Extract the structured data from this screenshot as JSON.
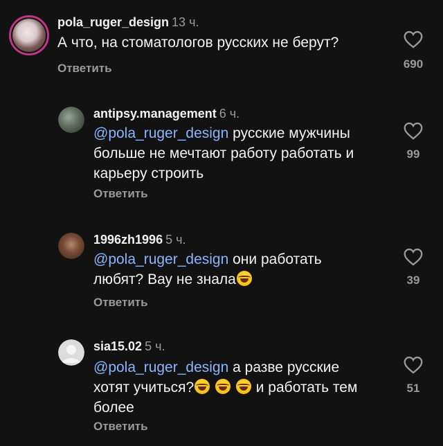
{
  "comments": [
    {
      "username": "pola_ruger_design",
      "time": "13 ч.",
      "text": "А что, на стоматологов русских не берут?",
      "reply_label": "Ответить",
      "likes": "690"
    },
    {
      "username": "antipsy.management",
      "time": "6 ч.",
      "mention": "@pola_ruger_design",
      "text": " русские мужчины больше не мечтают работу работать и карьеру строить",
      "reply_label": "Ответить",
      "likes": "99"
    },
    {
      "username": "1996zh1996",
      "time": "5 ч.",
      "mention": "@pola_ruger_design",
      "text": " они работать любят? Вау не знала",
      "emoji": "face-with-tears-of-joy",
      "reply_label": "Ответить",
      "likes": "39"
    },
    {
      "username": "sia15.02",
      "time": "5 ч.",
      "mention": "@pola_ruger_design",
      "text_a": " а разве русские хотят учиться?",
      "text_b": " и работать тем более",
      "emoji": "face-with-tears-of-joy",
      "reply_label": "Ответить",
      "likes": "51"
    }
  ],
  "icons": {
    "like": "heart-outline-icon",
    "emoji": "face-with-tears-of-joy"
  },
  "colors": {
    "background": "#121212",
    "mention": "#8ab4ff",
    "secondary": "#9a9a9a",
    "story_ring": "#c13584"
  }
}
